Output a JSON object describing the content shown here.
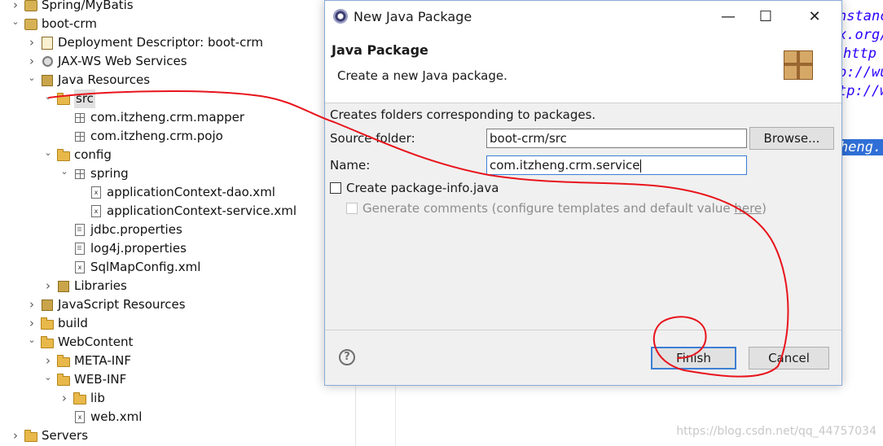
{
  "tree": {
    "items": [
      {
        "label": "Spring/MyBatis",
        "indent": 0,
        "toggle": "collapsed",
        "icon": "project-icon"
      },
      {
        "label": "boot-crm",
        "indent": 0,
        "toggle": "expanded",
        "icon": "project-icon"
      },
      {
        "label": "Deployment Descriptor: boot-crm",
        "indent": 1,
        "toggle": "collapsed",
        "icon": "deployment-descriptor-icon"
      },
      {
        "label": "JAX-WS Web Services",
        "indent": 1,
        "toggle": "collapsed",
        "icon": "web-services-icon"
      },
      {
        "label": "Java Resources",
        "indent": 1,
        "toggle": "expanded",
        "icon": "java-resources-icon"
      },
      {
        "label": "src",
        "indent": 2,
        "toggle": "expanded",
        "icon": "source-folder-icon"
      },
      {
        "label": "com.itzheng.crm.mapper",
        "indent": 3,
        "toggle": "none",
        "icon": "package-icon"
      },
      {
        "label": "com.itzheng.crm.pojo",
        "indent": 3,
        "toggle": "none",
        "icon": "package-icon"
      },
      {
        "label": "config",
        "indent": 2,
        "toggle": "expanded",
        "icon": "source-folder-icon"
      },
      {
        "label": "spring",
        "indent": 3,
        "toggle": "expanded",
        "icon": "package-icon"
      },
      {
        "label": "applicationContext-dao.xml",
        "indent": 4,
        "toggle": "none",
        "icon": "xml-file-icon"
      },
      {
        "label": "applicationContext-service.xml",
        "indent": 4,
        "toggle": "none",
        "icon": "xml-file-icon"
      },
      {
        "label": "jdbc.properties",
        "indent": 3,
        "toggle": "none",
        "icon": "properties-file-icon"
      },
      {
        "label": "log4j.properties",
        "indent": 3,
        "toggle": "none",
        "icon": "properties-file-icon"
      },
      {
        "label": "SqlMapConfig.xml",
        "indent": 3,
        "toggle": "none",
        "icon": "xml-file-icon"
      },
      {
        "label": "Libraries",
        "indent": 2,
        "toggle": "collapsed",
        "icon": "libraries-icon"
      },
      {
        "label": "JavaScript Resources",
        "indent": 1,
        "toggle": "collapsed",
        "icon": "javascript-resources-icon"
      },
      {
        "label": "build",
        "indent": 1,
        "toggle": "collapsed",
        "icon": "folder-icon"
      },
      {
        "label": "WebContent",
        "indent": 1,
        "toggle": "expanded",
        "icon": "folder-icon"
      },
      {
        "label": "META-INF",
        "indent": 2,
        "toggle": "collapsed",
        "icon": "folder-icon"
      },
      {
        "label": "WEB-INF",
        "indent": 2,
        "toggle": "expanded",
        "icon": "folder-icon"
      },
      {
        "label": "lib",
        "indent": 3,
        "toggle": "collapsed",
        "icon": "folder-icon"
      },
      {
        "label": "web.xml",
        "indent": 3,
        "toggle": "none",
        "icon": "xml-file-icon"
      },
      {
        "label": "Servers",
        "indent": 0,
        "toggle": "collapsed",
        "icon": "folder-icon"
      }
    ]
  },
  "editor": {
    "fragments": [
      "nstanc",
      "x.org/",
      "http",
      "p://wu",
      "tp://w",
      "heng."
    ]
  },
  "dialog": {
    "title": "New Java Package",
    "minimize_icon": "—",
    "maximize_icon": "☐",
    "close_icon": "✕",
    "header_title": "Java Package",
    "header_desc": "Create a new Java package.",
    "info": "Creates folders corresponding to packages.",
    "source_folder_label": "Source folder:",
    "source_folder_value": "boot-crm/src",
    "browse_label": "Browse...",
    "name_label": "Name:",
    "name_value": "com.itzheng.crm.service",
    "create_package_info_label": "Create package-info.java",
    "generate_comments_label": "Generate comments (configure templates and default value ",
    "generate_comments_link": "here",
    "generate_comments_suffix": ")",
    "help_icon": "?",
    "finish_label": "Finish",
    "cancel_label": "Cancel"
  },
  "watermark": "https://blog.csdn.net/qq_44757034",
  "colors": {
    "accent": "#3c7fd4",
    "annotation": "#e8141c",
    "selection": "#2f6fd6"
  }
}
